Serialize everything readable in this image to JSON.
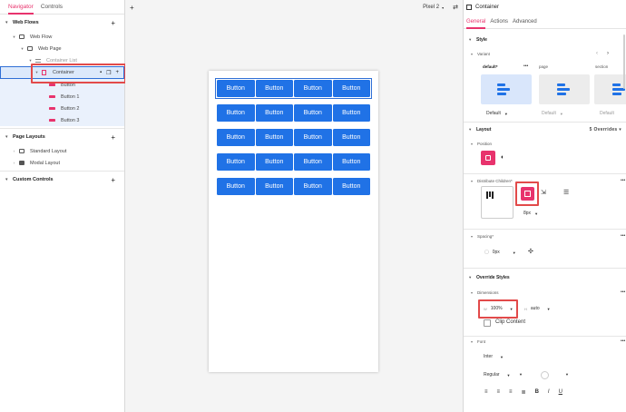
{
  "left_panel": {
    "tabs": [
      "Navigator",
      "Controls"
    ],
    "sections": {
      "web_flows": "Web Flows",
      "page_layouts": "Page Layouts",
      "custom_controls": "Custom Controls"
    },
    "tree": {
      "web_flow": "Web Flow",
      "web_page": "Web Page",
      "container_list": "Container List",
      "container": "Container",
      "button": "Button",
      "button1": "Button 1",
      "button2": "Button 2",
      "button3": "Button 3",
      "standard_layout": "Standard Layout",
      "modal_layout": "Modal Layout"
    }
  },
  "canvas": {
    "device": "Pixel 2",
    "buttons": [
      [
        "Button",
        "Button",
        "Button",
        "Button"
      ],
      [
        "Button",
        "Button",
        "Button",
        "Button"
      ],
      [
        "Button",
        "Button",
        "Button",
        "Button"
      ],
      [
        "Button",
        "Button",
        "Button",
        "Button"
      ],
      [
        "Button",
        "Button",
        "Button",
        "Button"
      ]
    ]
  },
  "inspector": {
    "title": "Container",
    "tabs": [
      "General",
      "Actions",
      "Advanced"
    ],
    "style": {
      "heading": "Style",
      "variant_label": "Variant",
      "variants": [
        "default*",
        "page",
        "section"
      ],
      "variant_selects": [
        "Default",
        "Default",
        "Default"
      ]
    },
    "layout": {
      "heading": "Layout",
      "overrides": "5 Overrides",
      "position_label": "Position",
      "distribute_label": "Distribute Children*",
      "gap_value": "8px",
      "spacing_label": "Spacing*",
      "spacing_value": "0px"
    },
    "override_styles": {
      "heading": "Override Styles",
      "dimensions_label": "Dimensions",
      "width_prefix": "W",
      "width_value": "100%",
      "height_prefix": "H",
      "height_value": "auto",
      "clip_content": "Clip Content",
      "font_label": "Font",
      "font_family": "Inter",
      "font_weight": "Regular"
    },
    "text_format_icons": [
      "align-left",
      "align-center",
      "align-right",
      "justify",
      "bold",
      "italic",
      "underline"
    ]
  },
  "colors": {
    "accent": "#e8336d",
    "button_blue": "#2072e6",
    "selection_blue": "#2f6fd6",
    "highlight_red": "#e24a4a"
  }
}
